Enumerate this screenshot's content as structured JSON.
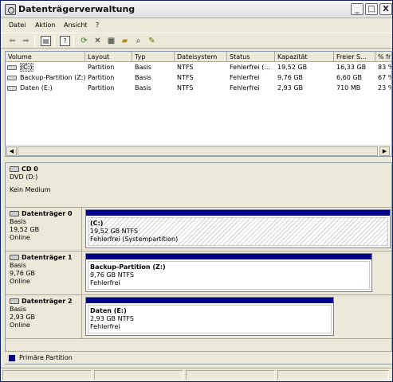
{
  "window": {
    "title": "Datenträgerverwaltung"
  },
  "controls": {
    "minimize": "_",
    "maximize": "□",
    "close": "X"
  },
  "menu": [
    "Datei",
    "Aktion",
    "Ansicht",
    "?"
  ],
  "toolbar": [
    "back-icon",
    "forward-icon",
    "console-tree-icon",
    "help-icon",
    "refresh-icon",
    "delete-icon",
    "properties-icon",
    "open-icon",
    "explore-icon",
    "wizard-icon"
  ],
  "list": {
    "columns": [
      "Volume",
      "Layout",
      "Typ",
      "Dateisystem",
      "Status",
      "Kapazität",
      "Freier S...",
      "% fr"
    ],
    "rows": [
      {
        "volume": "(C:)",
        "layout": "Partition",
        "typ": "Basis",
        "fs": "NTFS",
        "status": "Fehlerfrei (...",
        "kapazitaet": "19,52 GB",
        "frei": "16,33 GB",
        "prozent": "83 %"
      },
      {
        "volume": "Backup-Partition (Z:)",
        "layout": "Partition",
        "typ": "Basis",
        "fs": "NTFS",
        "status": "Fehlerfrei",
        "kapazitaet": "9,76 GB",
        "frei": "6,60 GB",
        "prozent": "67 %"
      },
      {
        "volume": "Daten (E:)",
        "layout": "Partition",
        "typ": "Basis",
        "fs": "NTFS",
        "status": "Fehlerfrei",
        "kapazitaet": "2,93 GB",
        "frei": "710 MB",
        "prozent": "23 %"
      }
    ]
  },
  "disks": {
    "cd": {
      "name": "CD 0",
      "line1": "DVD (D:)",
      "line2": "Kein Medium"
    },
    "d0": {
      "name": "Datenträger 0",
      "line1": "Basis",
      "line2": "19,52 GB",
      "line3": "Online",
      "part": {
        "name": "(C:)",
        "line1": "19,52 GB NTFS",
        "line2": "Fehlerfrei (Systempartition)"
      }
    },
    "d1": {
      "name": "Datenträger 1",
      "line1": "Basis",
      "line2": "9,76 GB",
      "line3": "Online",
      "part": {
        "name": "Backup-Partition  (Z:)",
        "line1": "9,76 GB NTFS",
        "line2": "Fehlerfrei"
      }
    },
    "d2": {
      "name": "Datenträger 2",
      "line1": "Basis",
      "line2": "2,93 GB",
      "line3": "Online",
      "part": {
        "name": "Daten  (E:)",
        "line1": "2,93 GB NTFS",
        "line2": "Fehlerfrei"
      }
    }
  },
  "legend": {
    "label": "Primäre Partition",
    "color": "#00008b"
  }
}
